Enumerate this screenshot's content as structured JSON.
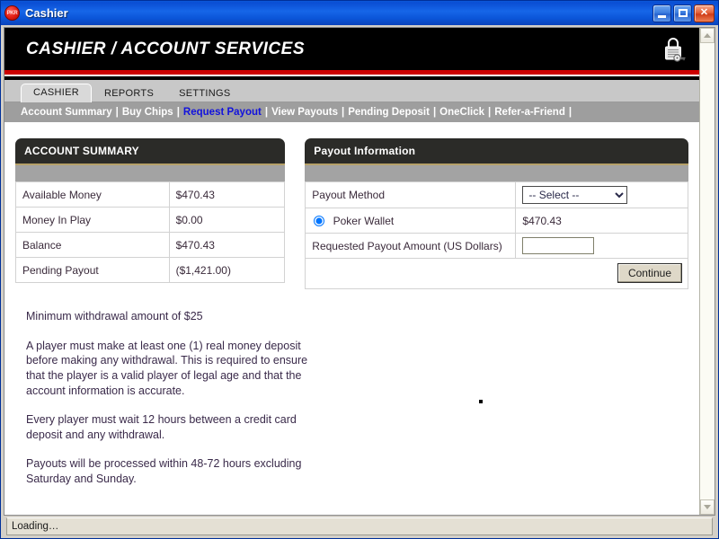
{
  "window": {
    "title": "Cashier",
    "app_icon": "poker-chip-icon",
    "minimize_label": "Minimize",
    "maximize_label": "Maximize",
    "close_label": "Close"
  },
  "banner": {
    "title": "CASHIER / ACCOUNT SERVICES",
    "lock_icon": "padlock-key-icon",
    "accent_color": "#cc0000",
    "background_color": "#000000"
  },
  "tabs": [
    {
      "label": "CASHIER",
      "active": true
    },
    {
      "label": "REPORTS",
      "active": false
    },
    {
      "label": "SETTINGS",
      "active": false
    }
  ],
  "subnav": {
    "items": [
      {
        "label": "Account Summary",
        "active": false
      },
      {
        "label": "Buy Chips",
        "active": false
      },
      {
        "label": "Request Payout",
        "active": true
      },
      {
        "label": "View Payouts",
        "active": false
      },
      {
        "label": "Pending Deposit",
        "active": false
      },
      {
        "label": "OneClick",
        "active": false
      },
      {
        "label": "Refer-a-Friend",
        "active": false
      }
    ],
    "separator": "|",
    "active_color": "#1111dd"
  },
  "account_summary": {
    "heading": "ACCOUNT SUMMARY",
    "rows": [
      {
        "label": "Available Money",
        "value": "$470.43"
      },
      {
        "label": "Money In Play",
        "value": "$0.00"
      },
      {
        "label": "Balance",
        "value": "$470.43"
      },
      {
        "label": "Pending Payout",
        "value": "($1,421.00)"
      }
    ]
  },
  "payout_information": {
    "heading": "Payout Information",
    "method_label": "Payout Method",
    "method_selected": "-- Select --",
    "method_options": [
      "-- Select --"
    ],
    "wallet_label": "Poker Wallet",
    "wallet_amount": "$470.43",
    "amount_label": "Requested Payout Amount (US Dollars)",
    "amount_value": "",
    "amount_placeholder": "",
    "continue_label": "Continue"
  },
  "notes": [
    "Minimum withdrawal amount of $25",
    "A player must make at least one (1) real money deposit before making any withdrawal. This is required to ensure that the player is a valid player of legal age and that the account information is accurate.",
    "Every player must wait 12 hours between a credit card deposit and any withdrawal.",
    "Payouts will be processed within 48-72 hours excluding Saturday and Sunday."
  ],
  "statusbar": {
    "text": "Loading…"
  },
  "scrollbar": {
    "up_icon": "chevron-up-icon",
    "down_icon": "chevron-down-icon"
  }
}
